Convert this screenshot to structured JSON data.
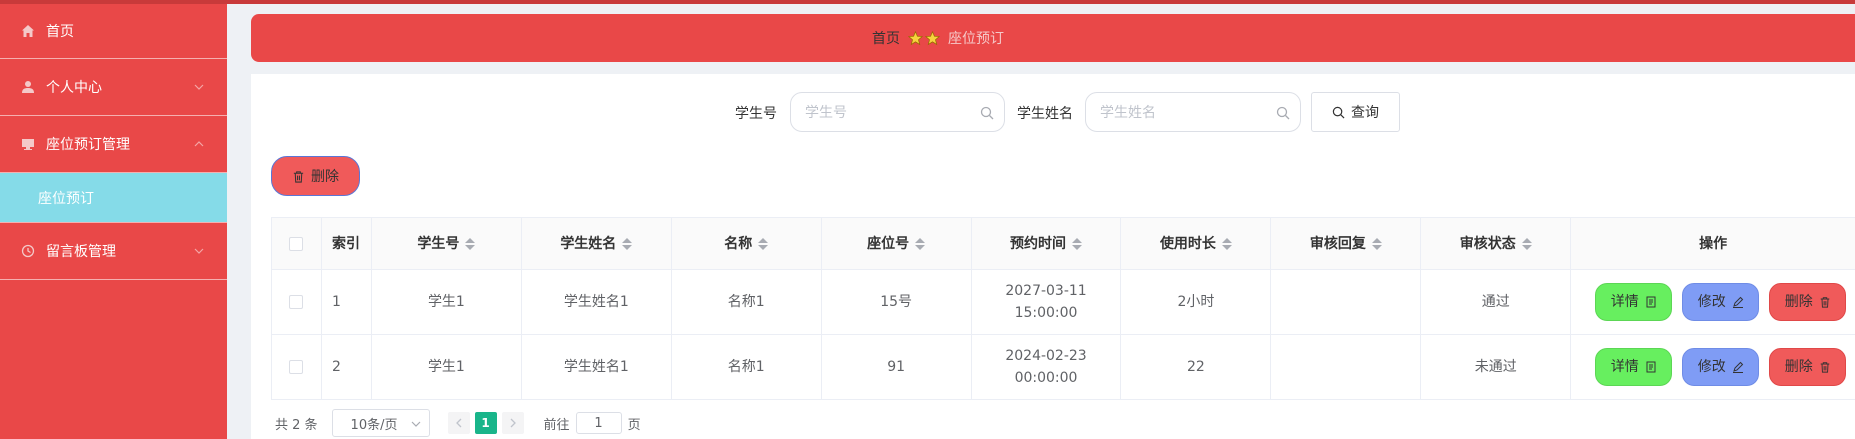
{
  "sidebar": {
    "items": [
      {
        "label": "首页",
        "icon": "home-icon"
      },
      {
        "label": "个人中心",
        "icon": "user-icon"
      },
      {
        "label": "座位预订管理",
        "icon": "monitor-icon"
      },
      {
        "label": "留言板管理",
        "icon": "clock-icon"
      }
    ],
    "sub_item": "座位预订"
  },
  "breadcrumb": {
    "home": "首页",
    "current": "座位预订"
  },
  "search": {
    "student_no_label": "学生号",
    "student_no_placeholder": "学生号",
    "student_name_label": "学生姓名",
    "student_name_placeholder": "学生姓名",
    "query_label": "查询"
  },
  "toolbar": {
    "delete_label": "删除"
  },
  "table": {
    "headers": [
      "索引",
      "学生号",
      "学生姓名",
      "名称",
      "座位号",
      "预约时间",
      "使用时长",
      "审核回复",
      "审核状态",
      "操作"
    ],
    "rows": [
      {
        "index": "1",
        "student_no": "学生1",
        "student_name": "学生姓名1",
        "name": "名称1",
        "seat": "15号",
        "time": "2027-03-11 15:00:00",
        "duration": "2小时",
        "reply": "",
        "status": "通过"
      },
      {
        "index": "2",
        "student_no": "学生1",
        "student_name": "学生姓名1",
        "name": "名称1",
        "seat": "91",
        "time": "2024-02-23 00:00:00",
        "duration": "22",
        "reply": "",
        "status": "未通过"
      }
    ],
    "actions": {
      "detail": "详情",
      "edit": "修改",
      "remove": "删除"
    }
  },
  "pagination": {
    "total": "共 2 条",
    "page_size": "10条/页",
    "current_page": "1",
    "goto_prefix": "前往",
    "goto_value": "1",
    "goto_suffix": "页"
  },
  "colors": {
    "primary": "#e94848",
    "active_sub": "#85dbe8",
    "detail": "#67ef5f",
    "edit": "#7f9cf5",
    "remove": "#f05a5a",
    "page_active": "#19b58a"
  }
}
